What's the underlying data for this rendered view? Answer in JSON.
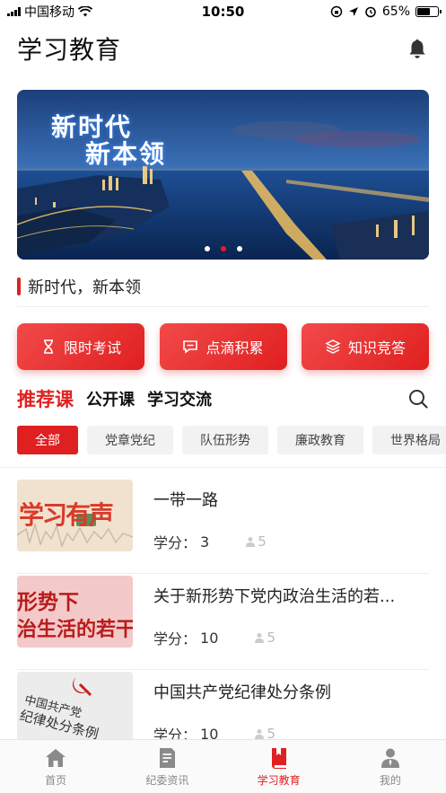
{
  "status_bar": {
    "carrier": "中国移动",
    "time": "10:50",
    "battery": "65%",
    "battery_level": 0.65
  },
  "header": {
    "title": "学习教育",
    "bell_icon": "bell-icon"
  },
  "banner": {
    "line1": "新时代",
    "line2": "新本领",
    "dots_total": 3,
    "active_dot": 1
  },
  "caption": "新时代，新本领",
  "quick_buttons": [
    {
      "label": "限时考试",
      "icon": "hourglass-icon"
    },
    {
      "label": "点滴积累",
      "icon": "chat-icon"
    },
    {
      "label": "知识竞答",
      "icon": "layers-icon"
    }
  ],
  "tabs": [
    "推荐课",
    "公开课",
    "学习交流"
  ],
  "chips": [
    "全部",
    "党章党纪",
    "队伍形势",
    "廉政教育",
    "世界格局"
  ],
  "courses": [
    {
      "title": "一带一路",
      "credit_label": "学分：",
      "credit": "3",
      "learners": "5",
      "thumb_text": "学习有声"
    },
    {
      "title": "关于新形势下党内政治生活的若...",
      "credit_label": "学分：",
      "credit": "10",
      "learners": "5",
      "thumb_text_1": "形势下",
      "thumb_text_2": "治生活的若干"
    },
    {
      "title": "中国共产党纪律处分条例",
      "credit_label": "学分：",
      "credit": "10",
      "learners": "5",
      "thumb_text_1": "中国共产党",
      "thumb_text_2": "纪律处分条例"
    }
  ],
  "bottom_nav": [
    {
      "label": "首页",
      "icon": "home-icon"
    },
    {
      "label": "纪委资讯",
      "icon": "document-icon"
    },
    {
      "label": "学习教育",
      "icon": "book-icon"
    },
    {
      "label": "我的",
      "icon": "user-icon"
    }
  ],
  "colors": {
    "accent": "#e02020",
    "chip_bg": "#f2f2f2"
  }
}
